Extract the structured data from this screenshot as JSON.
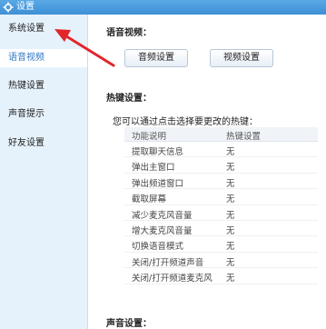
{
  "window": {
    "title": "设置",
    "icon": "gear-icon"
  },
  "sidebar": {
    "items": [
      {
        "label": "系统设置",
        "active": false
      },
      {
        "label": "语音视频",
        "active": true
      },
      {
        "label": "热键设置",
        "active": false
      },
      {
        "label": "声音提示",
        "active": false
      },
      {
        "label": "好友设置",
        "active": false
      }
    ]
  },
  "content": {
    "voice_video_heading": "语音视频：",
    "audio_button": "音频设置",
    "video_button": "视频设置",
    "hotkey_heading": "热键设置：",
    "hotkey_hint": "您可以通过点击选择要更改的热键：",
    "table": {
      "headers": [
        "功能说明",
        "热键设置"
      ],
      "rows": [
        [
          "提取聊天信息",
          "无"
        ],
        [
          "弹出主窗口",
          "无"
        ],
        [
          "弹出频道窗口",
          "无"
        ],
        [
          "截取屏幕",
          "无"
        ],
        [
          "减少麦克风音量",
          "无"
        ],
        [
          "增大麦克风音量",
          "无"
        ],
        [
          "切换语音模式",
          "无"
        ],
        [
          "关闭/打开频道声音",
          "无"
        ],
        [
          "关闭/打开频道麦克风",
          "无"
        ]
      ]
    },
    "sound_heading": "声音设置："
  },
  "colors": {
    "titlebar": "#3d8fd6",
    "sidebar_bg": "#e6f2fb",
    "active_text": "#2f78c4",
    "arrow": "#e0262a"
  }
}
